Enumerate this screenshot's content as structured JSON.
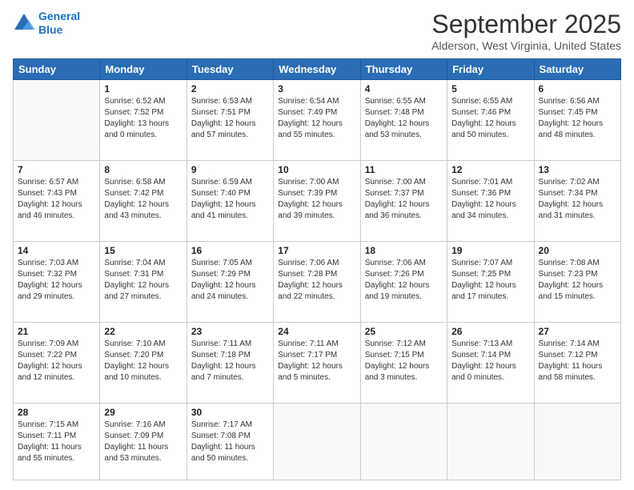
{
  "logo": {
    "line1": "General",
    "line2": "Blue"
  },
  "title": "September 2025",
  "subtitle": "Alderson, West Virginia, United States",
  "days_header": [
    "Sunday",
    "Monday",
    "Tuesday",
    "Wednesday",
    "Thursday",
    "Friday",
    "Saturday"
  ],
  "weeks": [
    [
      {
        "day": "",
        "info": ""
      },
      {
        "day": "1",
        "info": "Sunrise: 6:52 AM\nSunset: 7:52 PM\nDaylight: 13 hours\nand 0 minutes."
      },
      {
        "day": "2",
        "info": "Sunrise: 6:53 AM\nSunset: 7:51 PM\nDaylight: 12 hours\nand 57 minutes."
      },
      {
        "day": "3",
        "info": "Sunrise: 6:54 AM\nSunset: 7:49 PM\nDaylight: 12 hours\nand 55 minutes."
      },
      {
        "day": "4",
        "info": "Sunrise: 6:55 AM\nSunset: 7:48 PM\nDaylight: 12 hours\nand 53 minutes."
      },
      {
        "day": "5",
        "info": "Sunrise: 6:55 AM\nSunset: 7:46 PM\nDaylight: 12 hours\nand 50 minutes."
      },
      {
        "day": "6",
        "info": "Sunrise: 6:56 AM\nSunset: 7:45 PM\nDaylight: 12 hours\nand 48 minutes."
      }
    ],
    [
      {
        "day": "7",
        "info": "Sunrise: 6:57 AM\nSunset: 7:43 PM\nDaylight: 12 hours\nand 46 minutes."
      },
      {
        "day": "8",
        "info": "Sunrise: 6:58 AM\nSunset: 7:42 PM\nDaylight: 12 hours\nand 43 minutes."
      },
      {
        "day": "9",
        "info": "Sunrise: 6:59 AM\nSunset: 7:40 PM\nDaylight: 12 hours\nand 41 minutes."
      },
      {
        "day": "10",
        "info": "Sunrise: 7:00 AM\nSunset: 7:39 PM\nDaylight: 12 hours\nand 39 minutes."
      },
      {
        "day": "11",
        "info": "Sunrise: 7:00 AM\nSunset: 7:37 PM\nDaylight: 12 hours\nand 36 minutes."
      },
      {
        "day": "12",
        "info": "Sunrise: 7:01 AM\nSunset: 7:36 PM\nDaylight: 12 hours\nand 34 minutes."
      },
      {
        "day": "13",
        "info": "Sunrise: 7:02 AM\nSunset: 7:34 PM\nDaylight: 12 hours\nand 31 minutes."
      }
    ],
    [
      {
        "day": "14",
        "info": "Sunrise: 7:03 AM\nSunset: 7:32 PM\nDaylight: 12 hours\nand 29 minutes."
      },
      {
        "day": "15",
        "info": "Sunrise: 7:04 AM\nSunset: 7:31 PM\nDaylight: 12 hours\nand 27 minutes."
      },
      {
        "day": "16",
        "info": "Sunrise: 7:05 AM\nSunset: 7:29 PM\nDaylight: 12 hours\nand 24 minutes."
      },
      {
        "day": "17",
        "info": "Sunrise: 7:06 AM\nSunset: 7:28 PM\nDaylight: 12 hours\nand 22 minutes."
      },
      {
        "day": "18",
        "info": "Sunrise: 7:06 AM\nSunset: 7:26 PM\nDaylight: 12 hours\nand 19 minutes."
      },
      {
        "day": "19",
        "info": "Sunrise: 7:07 AM\nSunset: 7:25 PM\nDaylight: 12 hours\nand 17 minutes."
      },
      {
        "day": "20",
        "info": "Sunrise: 7:08 AM\nSunset: 7:23 PM\nDaylight: 12 hours\nand 15 minutes."
      }
    ],
    [
      {
        "day": "21",
        "info": "Sunrise: 7:09 AM\nSunset: 7:22 PM\nDaylight: 12 hours\nand 12 minutes."
      },
      {
        "day": "22",
        "info": "Sunrise: 7:10 AM\nSunset: 7:20 PM\nDaylight: 12 hours\nand 10 minutes."
      },
      {
        "day": "23",
        "info": "Sunrise: 7:11 AM\nSunset: 7:18 PM\nDaylight: 12 hours\nand 7 minutes."
      },
      {
        "day": "24",
        "info": "Sunrise: 7:11 AM\nSunset: 7:17 PM\nDaylight: 12 hours\nand 5 minutes."
      },
      {
        "day": "25",
        "info": "Sunrise: 7:12 AM\nSunset: 7:15 PM\nDaylight: 12 hours\nand 3 minutes."
      },
      {
        "day": "26",
        "info": "Sunrise: 7:13 AM\nSunset: 7:14 PM\nDaylight: 12 hours\nand 0 minutes."
      },
      {
        "day": "27",
        "info": "Sunrise: 7:14 AM\nSunset: 7:12 PM\nDaylight: 11 hours\nand 58 minutes."
      }
    ],
    [
      {
        "day": "28",
        "info": "Sunrise: 7:15 AM\nSunset: 7:11 PM\nDaylight: 11 hours\nand 55 minutes."
      },
      {
        "day": "29",
        "info": "Sunrise: 7:16 AM\nSunset: 7:09 PM\nDaylight: 11 hours\nand 53 minutes."
      },
      {
        "day": "30",
        "info": "Sunrise: 7:17 AM\nSunset: 7:08 PM\nDaylight: 11 hours\nand 50 minutes."
      },
      {
        "day": "",
        "info": ""
      },
      {
        "day": "",
        "info": ""
      },
      {
        "day": "",
        "info": ""
      },
      {
        "day": "",
        "info": ""
      }
    ]
  ]
}
